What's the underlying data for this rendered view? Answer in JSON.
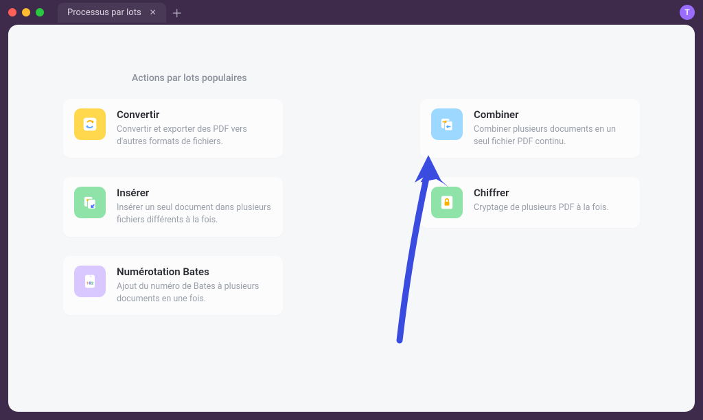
{
  "titlebar": {
    "tab_title": "Processus par lots",
    "avatar_initial": "T"
  },
  "section_label": "Actions par lots populaires",
  "cards": {
    "convert": {
      "title": "Convertir",
      "desc": "Convertir et exporter des PDF vers d'autres formats de fichiers.",
      "bg": "#ffd84d"
    },
    "combine": {
      "title": "Combiner",
      "desc": "Combiner plusieurs documents en un seul fichier PDF continu.",
      "bg": "#9cd8ff"
    },
    "insert": {
      "title": "Insérer",
      "desc": "Insérer un seul document dans plusieurs fichiers différents à la fois.",
      "bg": "#8fe3a8"
    },
    "encrypt": {
      "title": "Chiffrer",
      "desc": "Cryptage de plusieurs PDF à la fois.",
      "bg": "#8fe3a8"
    },
    "bates": {
      "title": "Numérotation Bates",
      "desc": "Ajout du numéro de Bates à plusieurs documents en une fois.",
      "bg": "#d9c7ff"
    }
  },
  "colors": {
    "accent_arrow": "#3a4bdf"
  }
}
